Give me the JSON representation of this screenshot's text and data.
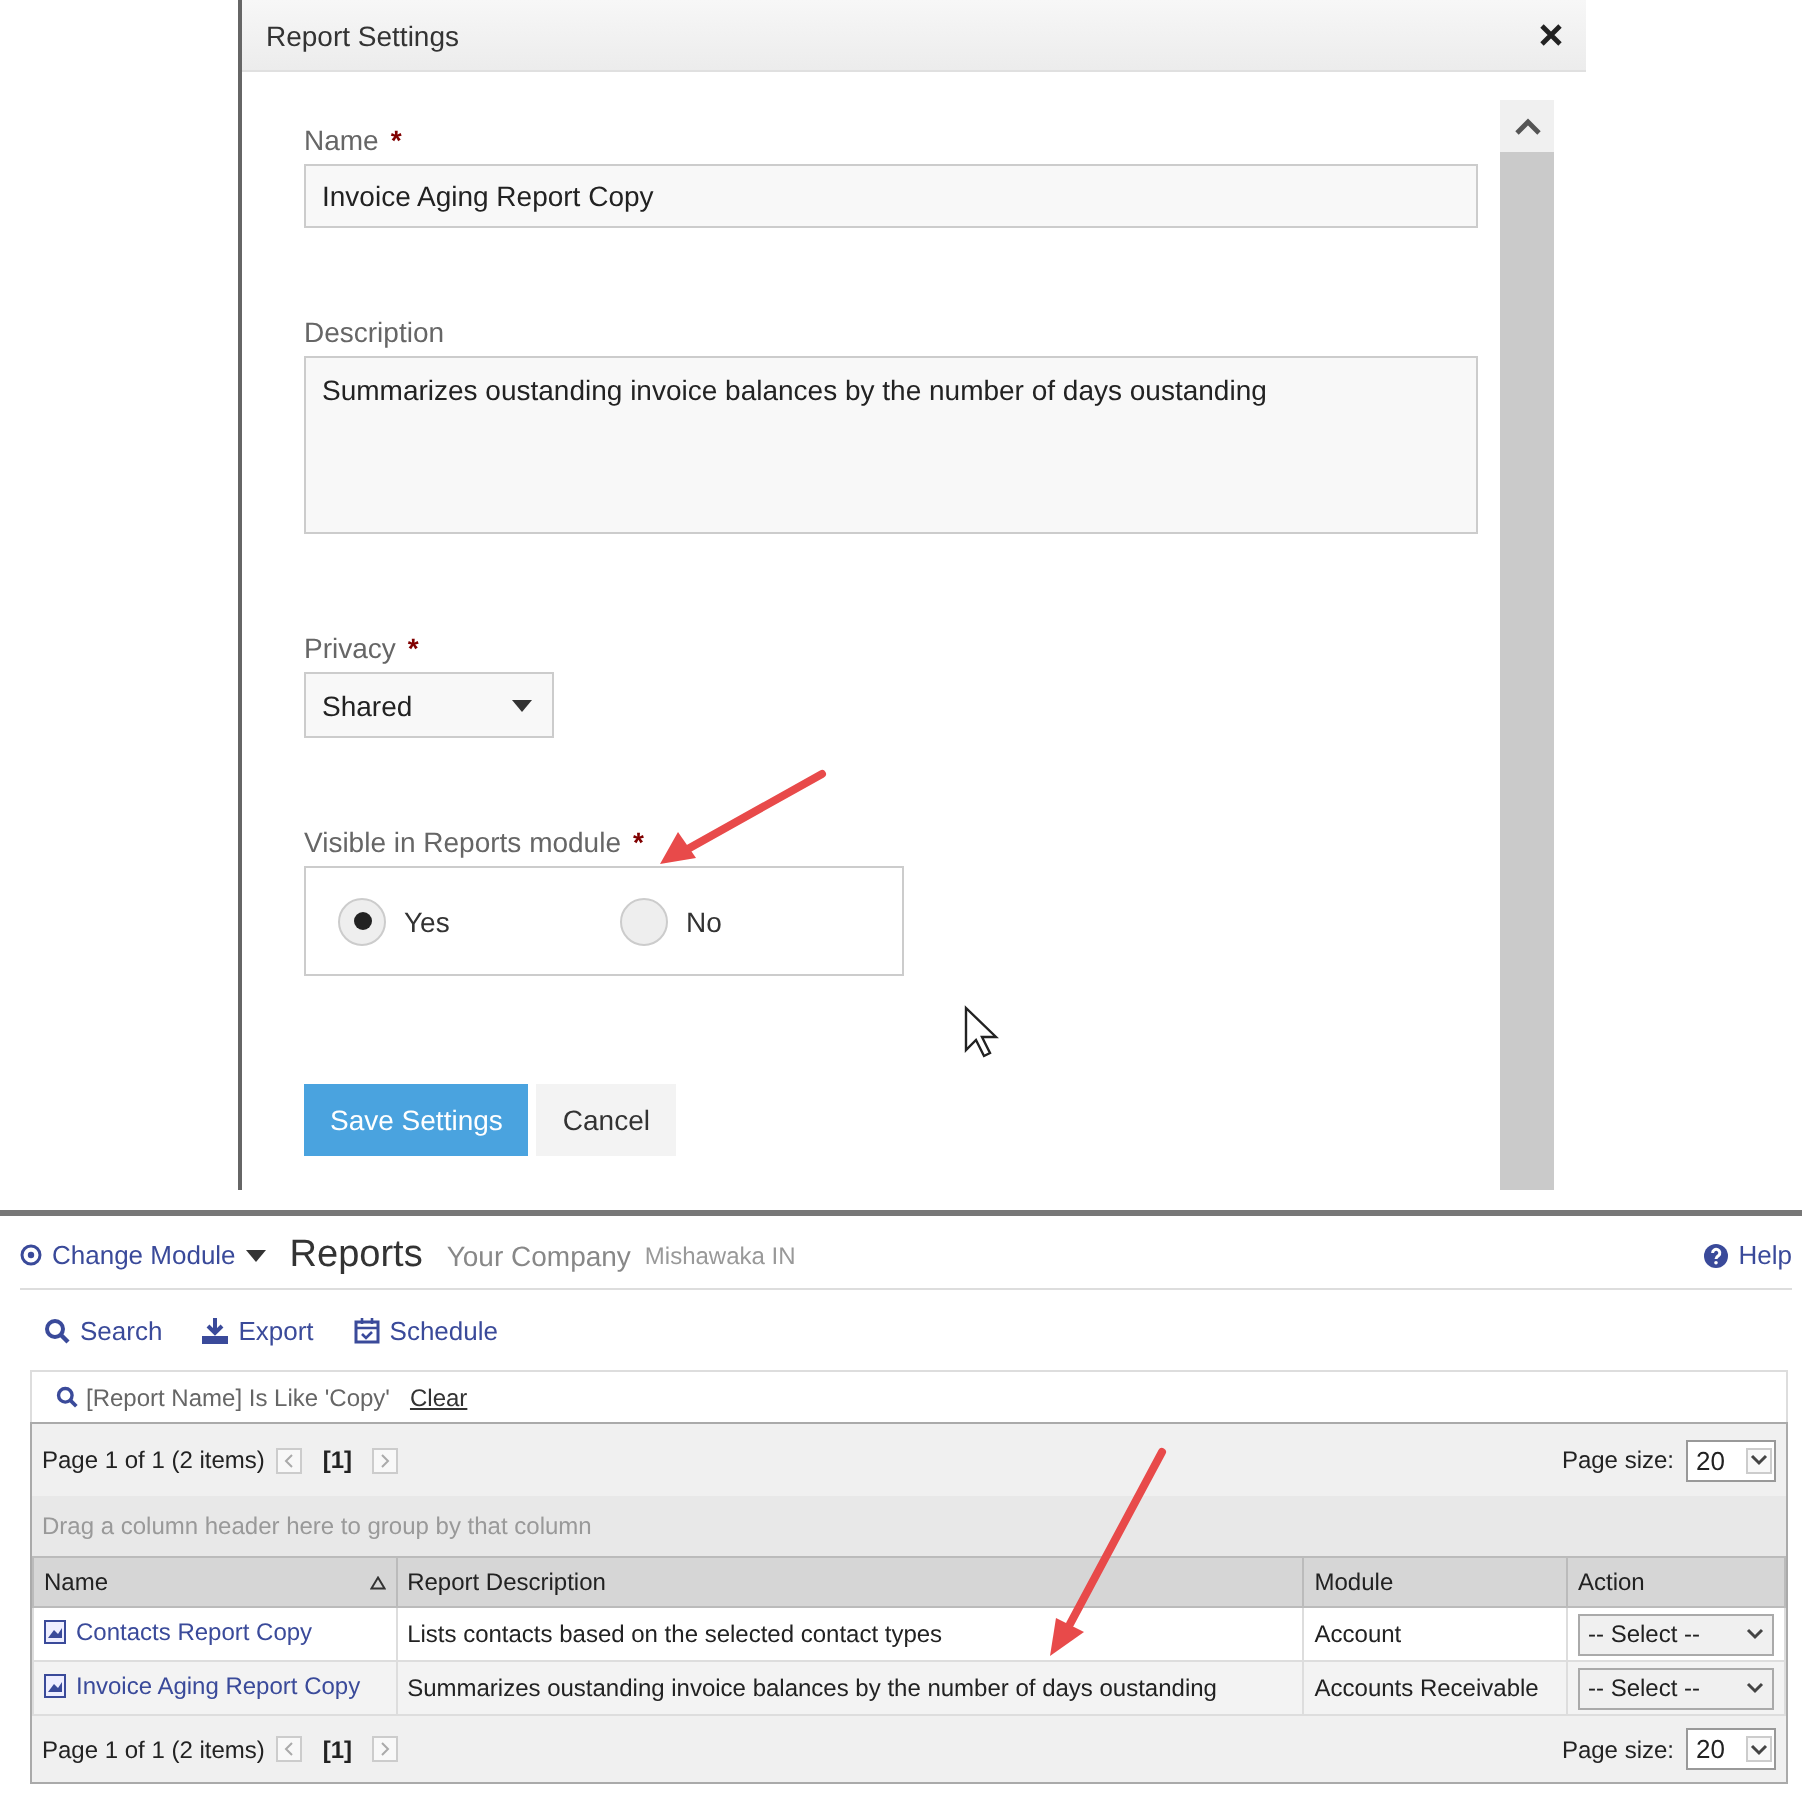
{
  "dialog": {
    "title": "Report Settings",
    "fields": [
      {
        "kind": "text",
        "label": "Name",
        "required_mark": "*",
        "value": "Invoice Aging Report Copy"
      },
      {
        "kind": "textarea",
        "label": "Description",
        "value": "Summarizes oustanding invoice balances by the number of days oustanding"
      },
      {
        "kind": "select",
        "label": "Privacy",
        "required_mark": "*",
        "value": "Shared"
      },
      {
        "kind": "radio",
        "label": "Visible in Reports module",
        "required_mark": "*",
        "options": [
          {
            "label": "Yes",
            "selected": true
          },
          {
            "label": "No",
            "selected": false
          }
        ]
      }
    ],
    "buttons": [
      {
        "label": "Save Settings",
        "kind": "primary"
      },
      {
        "label": "Cancel",
        "kind": "secondary"
      }
    ]
  },
  "reports": {
    "module_menu": "Change Module",
    "title": "Reports",
    "company": "Your Company",
    "location": "Mishawaka IN",
    "help": "Help",
    "toolbar": [
      {
        "label": "Search",
        "kind": "search"
      },
      {
        "label": "Export",
        "kind": "export"
      },
      {
        "label": "Schedule",
        "kind": "schedule"
      }
    ],
    "filter": {
      "text": "[Report Name] Is Like 'Copy'",
      "clear": "Clear"
    },
    "pager_top": {
      "summary": "Page 1 of 1 (2 items)",
      "current": "[1]",
      "size_label": "Page size:",
      "size": "20"
    },
    "group_panel": "Drag a column header here to group by that column",
    "columns": [
      {
        "label": "Name",
        "sorted": true
      },
      {
        "label": "Report Description",
        "sorted": false
      },
      {
        "label": "Module",
        "sorted": false
      },
      {
        "label": "Action",
        "sorted": false
      }
    ],
    "rows": [
      {
        "name": "Contacts Report Copy",
        "description": "Lists contacts based on the selected contact types",
        "module": "Account",
        "action": "-- Select --"
      },
      {
        "name": "Invoice Aging Report Copy",
        "description": "Summarizes oustanding invoice balances by the number of days oustanding",
        "module": "Accounts Receivable",
        "action": "-- Select --"
      }
    ],
    "pager_bottom": {
      "summary": "Page 1 of 1 (2 items)",
      "current": "[1]",
      "size_label": "Page size:",
      "size": "20"
    }
  }
}
